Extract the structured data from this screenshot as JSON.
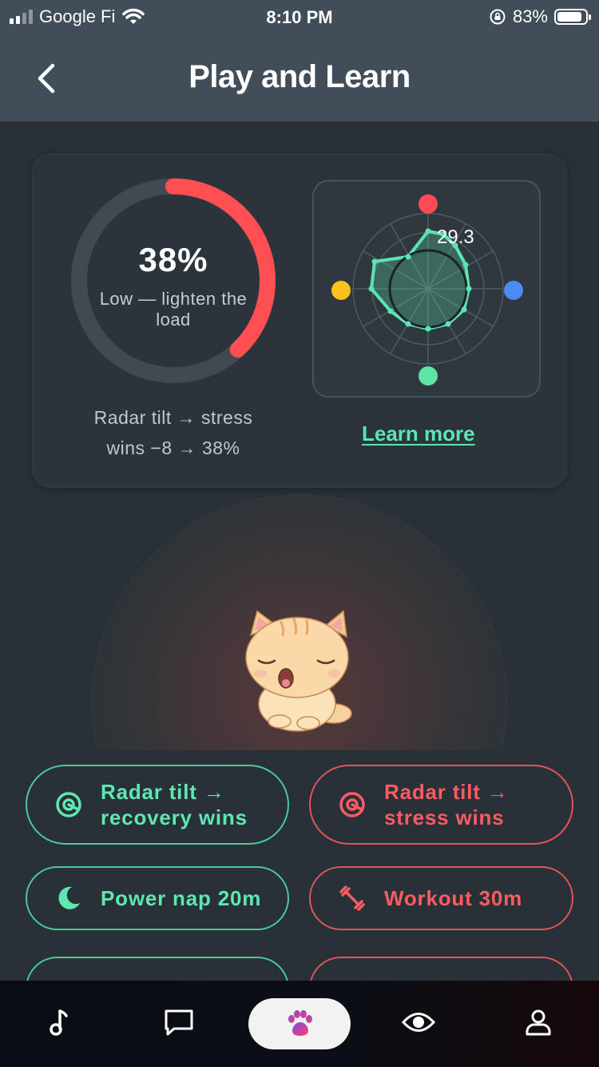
{
  "status": {
    "carrier": "Google Fi",
    "time": "8:10 PM",
    "battery": "83%"
  },
  "header": {
    "title": "Play and Learn"
  },
  "stress_card": {
    "percent": "38%",
    "level_text": "Low — lighten the load",
    "caption_line1": "Radar tilt → stress",
    "caption_line2": "wins  −8 → 38%",
    "radar_value": "29.3",
    "learn_more": "Learn more",
    "ring_progress": 0.38
  },
  "actions": [
    {
      "label_line1": "Radar tilt →",
      "label_line2": "recovery wins",
      "tone": "green",
      "icon": "radar-icon"
    },
    {
      "label_line1": "Radar tilt →",
      "label_line2": "stress wins",
      "tone": "red",
      "icon": "radar-icon"
    },
    {
      "label": "Power nap 20m",
      "tone": "green",
      "icon": "moon-icon"
    },
    {
      "label": "Workout 30m",
      "tone": "red",
      "icon": "dumbbell-icon"
    }
  ],
  "colors": {
    "green": "#5fe6b1",
    "red": "#ff5b60",
    "header": "#414d59",
    "background": "#283137"
  },
  "tabs": [
    "music-icon",
    "chat-icon",
    "paw-icon",
    "eye-icon",
    "profile-icon"
  ]
}
